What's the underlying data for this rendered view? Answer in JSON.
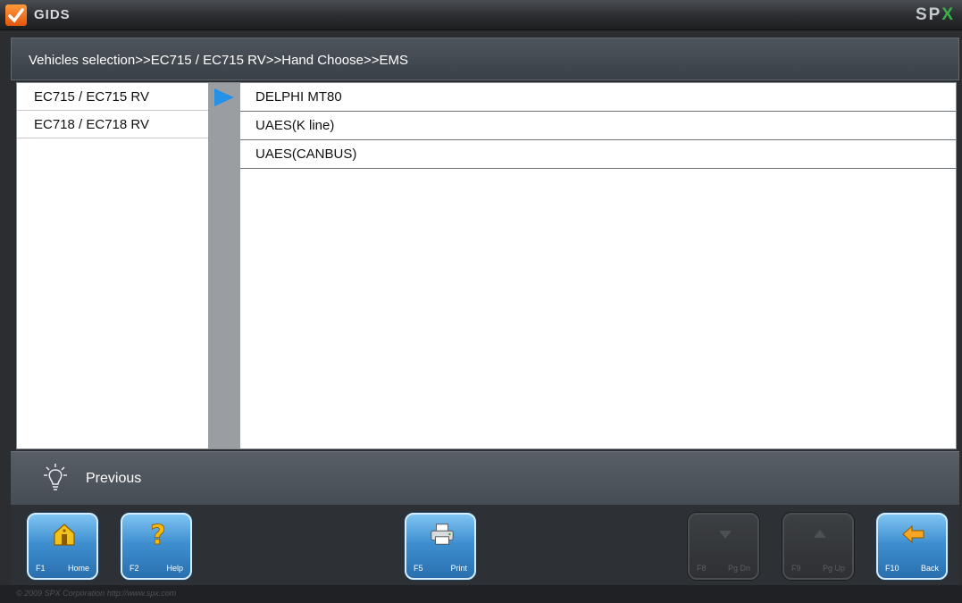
{
  "titlebar": {
    "app_name": "GIDS",
    "brand_main": "SP",
    "brand_x": "X"
  },
  "breadcrumb": "Vehicles selection>>EC715 / EC715 RV>>Hand Choose>>EMS",
  "left_list": {
    "items": [
      {
        "label": "EC715 / EC715 RV",
        "selected": true
      },
      {
        "label": "EC718 / EC718 RV",
        "selected": false
      }
    ]
  },
  "right_list": {
    "items": [
      {
        "label": "DELPHI MT80"
      },
      {
        "label": "UAES(K line)"
      },
      {
        "label": "UAES(CANBUS)"
      }
    ]
  },
  "hint": {
    "text": "Previous",
    "icon": "lightbulb-icon"
  },
  "toolbar": {
    "home": {
      "key": "F1",
      "label": "Home",
      "icon": "home-icon",
      "enabled": true
    },
    "help": {
      "key": "F2",
      "label": "Help",
      "icon": "question-icon",
      "enabled": true
    },
    "print": {
      "key": "F5",
      "label": "Print",
      "icon": "printer-icon",
      "enabled": true
    },
    "pgdn": {
      "key": "F8",
      "label": "Pg Dn",
      "icon": "arrow-down-icon",
      "enabled": false
    },
    "pgup": {
      "key": "F9",
      "label": "Pg Up",
      "icon": "arrow-up-icon",
      "enabled": false
    },
    "back": {
      "key": "F10",
      "label": "Back",
      "icon": "back-arrow-icon",
      "enabled": true
    }
  },
  "footer": {
    "copyright": "© 2009 SPX Corporation    http://www.spx.com"
  },
  "colors": {
    "accent": "#2592e8",
    "button_blue": "#3f8fd0",
    "brand_green": "#38b24a",
    "logo_orange": "#e2560e"
  }
}
